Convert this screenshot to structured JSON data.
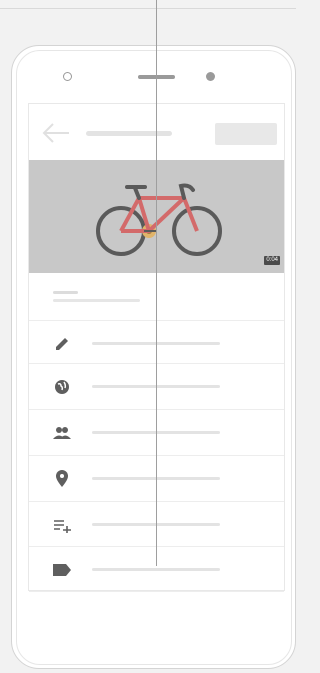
{
  "video": {
    "duration": "0:04",
    "thumbnail_subject": "bicycle",
    "colors": {
      "frame": "#d36a6a",
      "wheels": "#555555",
      "chainring": "#e0b46a",
      "background": "#c8c8c8"
    }
  },
  "rows": [
    {
      "icon": "pencil-icon"
    },
    {
      "icon": "globe-icon"
    },
    {
      "icon": "people-icon"
    },
    {
      "icon": "location-pin-icon"
    },
    {
      "icon": "playlist-add-icon"
    },
    {
      "icon": "label-tag-icon"
    }
  ],
  "colors": {
    "icon": "#5f5f5f",
    "placeholder": "#e3e3e3",
    "page_background": "#f2f2f2"
  }
}
